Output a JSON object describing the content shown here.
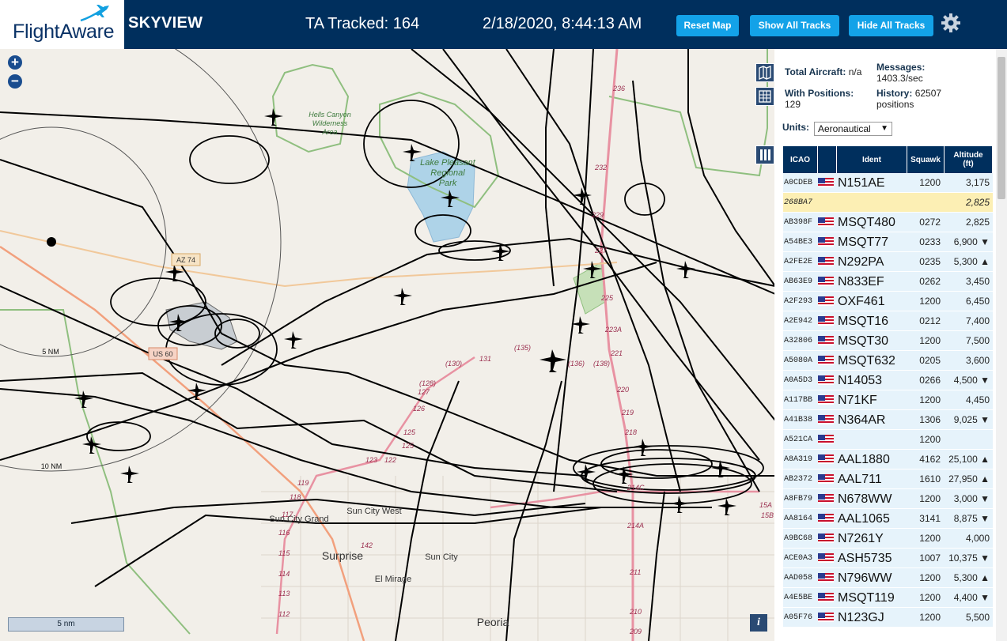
{
  "header": {
    "logo_text": "FlightAware",
    "app_title": "SKYVIEW",
    "ta_tracked": "TA Tracked: 164",
    "datetime": "2/18/2020, 8:44:13 AM",
    "buttons": {
      "reset_map": "Reset Map",
      "show_all_tracks": "Show All Tracks",
      "hide_all_tracks": "Hide All Tracks"
    },
    "settings_icon": "gear-icon"
  },
  "map": {
    "zoom_in": "+",
    "zoom_out": "−",
    "scale_label": "5 nm",
    "info_label": "i",
    "places": {
      "hells_canyon": [
        "Hells Canyon",
        "Wilderness",
        "Area"
      ],
      "lake_pleasant": [
        "Lake Pleasant",
        "Regional",
        "Park"
      ],
      "sun_city_grand": "Sun City Grand",
      "sun_city_west": "Sun City West",
      "surprise": "Surprise",
      "sun_city": "Sun City",
      "el_mirage": "El Mirage",
      "peoria": "Peoria",
      "az74": "AZ 74",
      "us60": "US 60",
      "ring_5nm": "5 NM",
      "ring_10nm": "10 NM"
    },
    "route_labels": [
      "236",
      "232",
      "229",
      "227",
      "225",
      "223A",
      "221",
      "220",
      "219",
      "218",
      "214C",
      "214A",
      "211",
      "210",
      "209",
      "(135)",
      "(136)",
      "(138)",
      "(130)",
      "(128)",
      "127",
      "126",
      "125",
      "125",
      "123",
      "122",
      "131",
      "119",
      "118",
      "117",
      "116",
      "115",
      "114",
      "113",
      "112",
      "142",
      "15A",
      "15B"
    ]
  },
  "sidebar": {
    "total_aircraft_label": "Total Aircraft:",
    "total_aircraft_value": "n/a",
    "messages_label": "Messages:",
    "messages_value": "1403.3/sec",
    "with_positions_label": "With Positions:",
    "with_positions_value": "129",
    "history_label": "History:",
    "history_value": "62507",
    "history_unit": "positions",
    "units_label": "Units:",
    "units_value": "Aeronautical",
    "table": {
      "headers": {
        "icao": "ICAO",
        "ident": "Ident",
        "squawk": "Squawk",
        "altitude": "Altitude",
        "altitude_unit": "(ft)"
      },
      "rows": [
        {
          "icao": "A0CDEB",
          "ident": "N151AE",
          "squawk": "1200",
          "alt": "3,175",
          "flag": true,
          "hl": false
        },
        {
          "icao": "268BA7",
          "ident": "",
          "squawk": "",
          "alt": "2,825",
          "flag": false,
          "hl": true
        },
        {
          "icao": "AB398F",
          "ident": "MSQT480",
          "squawk": "0272",
          "alt": "2,825",
          "flag": true,
          "hl": false
        },
        {
          "icao": "A54BE3",
          "ident": "MSQT77",
          "squawk": "0233",
          "alt": "6,900 ▼",
          "flag": true,
          "hl": false
        },
        {
          "icao": "A2FE2E",
          "ident": "N292PA",
          "squawk": "0235",
          "alt": "5,300 ▲",
          "flag": true,
          "hl": false
        },
        {
          "icao": "AB63E9",
          "ident": "N833EF",
          "squawk": "0262",
          "alt": "3,450",
          "flag": true,
          "hl": false
        },
        {
          "icao": "A2F293",
          "ident": "OXF461",
          "squawk": "1200",
          "alt": "6,450",
          "flag": true,
          "hl": false
        },
        {
          "icao": "A2E942",
          "ident": "MSQT16",
          "squawk": "0212",
          "alt": "7,400",
          "flag": true,
          "hl": false
        },
        {
          "icao": "A32806",
          "ident": "MSQT30",
          "squawk": "1200",
          "alt": "7,500",
          "flag": true,
          "hl": false
        },
        {
          "icao": "A5080A",
          "ident": "MSQT632",
          "squawk": "0205",
          "alt": "3,600",
          "flag": true,
          "hl": false
        },
        {
          "icao": "A0A5D3",
          "ident": "N14053",
          "squawk": "0266",
          "alt": "4,500 ▼",
          "flag": true,
          "hl": false
        },
        {
          "icao": "A117BB",
          "ident": "N71KF",
          "squawk": "1200",
          "alt": "4,450",
          "flag": true,
          "hl": false
        },
        {
          "icao": "A41B38",
          "ident": "N364AR",
          "squawk": "1306",
          "alt": "9,025 ▼",
          "flag": true,
          "hl": false
        },
        {
          "icao": "A521CA",
          "ident": "",
          "squawk": "1200",
          "alt": "",
          "flag": true,
          "hl": false
        },
        {
          "icao": "A8A319",
          "ident": "AAL1880",
          "squawk": "4162",
          "alt": "25,100 ▲",
          "flag": true,
          "hl": false
        },
        {
          "icao": "AB2372",
          "ident": "AAL711",
          "squawk": "1610",
          "alt": "27,950 ▲",
          "flag": true,
          "hl": false
        },
        {
          "icao": "A8FB79",
          "ident": "N678WW",
          "squawk": "1200",
          "alt": "3,000 ▼",
          "flag": true,
          "hl": false
        },
        {
          "icao": "AA8164",
          "ident": "AAL1065",
          "squawk": "3141",
          "alt": "8,875 ▼",
          "flag": true,
          "hl": false
        },
        {
          "icao": "A9BC68",
          "ident": "N7261Y",
          "squawk": "1200",
          "alt": "4,000",
          "flag": true,
          "hl": false
        },
        {
          "icao": "ACE0A3",
          "ident": "ASH5735",
          "squawk": "1007",
          "alt": "10,375 ▼",
          "flag": true,
          "hl": false
        },
        {
          "icao": "AAD058",
          "ident": "N796WW",
          "squawk": "1200",
          "alt": "5,300 ▲",
          "flag": true,
          "hl": false
        },
        {
          "icao": "A4E5BE",
          "ident": "MSQT119",
          "squawk": "1200",
          "alt": "4,400 ▼",
          "flag": true,
          "hl": false
        },
        {
          "icao": "A05F76",
          "ident": "N123GJ",
          "squawk": "1200",
          "alt": "5,500",
          "flag": true,
          "hl": false
        }
      ]
    }
  },
  "colors": {
    "header_bg": "#002f5d",
    "button_bg": "#13a2e8",
    "row_bg": "#e6f3fb",
    "row_highlight": "#fcefb4",
    "map_bg": "#f2efe9",
    "park_border": "#8fbf7f",
    "lake": "#aed3e8",
    "highway": "#e892a2",
    "track": "#000000"
  }
}
